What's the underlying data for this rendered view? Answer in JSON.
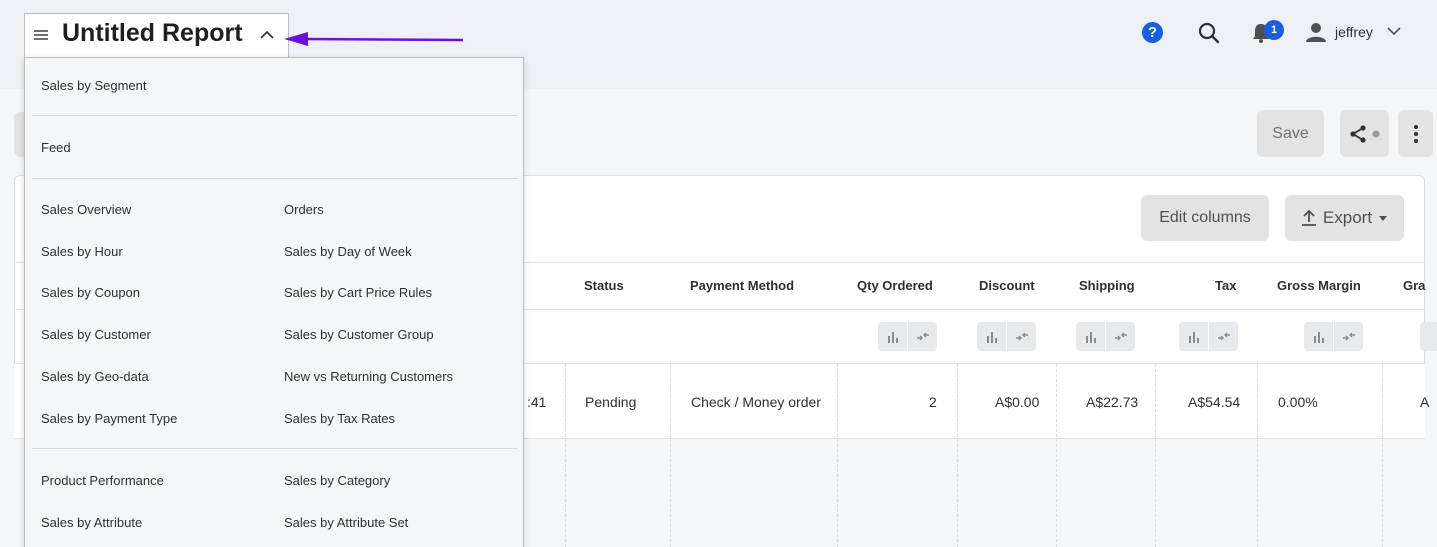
{
  "header": {
    "report_title": "Untitled Report",
    "help_label": "?",
    "notification_count": "1",
    "username": "jeffrey"
  },
  "actions": {
    "save_label": "Save",
    "edit_columns_label": "Edit columns",
    "export_label": "Export"
  },
  "table": {
    "columns": [
      "Status",
      "Payment Method",
      "Qty Ordered",
      "Discount",
      "Shipping",
      "Tax",
      "Gross Margin",
      "Gra"
    ],
    "row": {
      "time_fragment": ":41",
      "status": "Pending",
      "payment_method": "Check / Money order",
      "qty_ordered": "2",
      "discount": "A$0.00",
      "shipping": "A$22.73",
      "tax": "A$54.54",
      "gross_margin": "0.00%",
      "grand_fragment": "A"
    }
  },
  "dropdown": {
    "group1": [
      "Sales by Segment"
    ],
    "group2": [
      "Feed"
    ],
    "group3_left": [
      "Sales Overview",
      "Sales by Hour",
      "Sales by Coupon",
      "Sales by Customer",
      "Sales by Geo-data",
      "Sales by Payment Type"
    ],
    "group3_right": [
      "Orders",
      "Sales by Day of Week",
      "Sales by Cart Price Rules",
      "Sales by Customer Group",
      "New vs Returning Customers",
      "Sales by Tax Rates"
    ],
    "group4_left": [
      "Product Performance",
      "Sales by Attribute"
    ],
    "group4_right": [
      "Sales by Category",
      "Sales by Attribute Set"
    ]
  },
  "colors": {
    "accent": "#1a5fe0",
    "annotation_arrow": "#6a11e0"
  }
}
